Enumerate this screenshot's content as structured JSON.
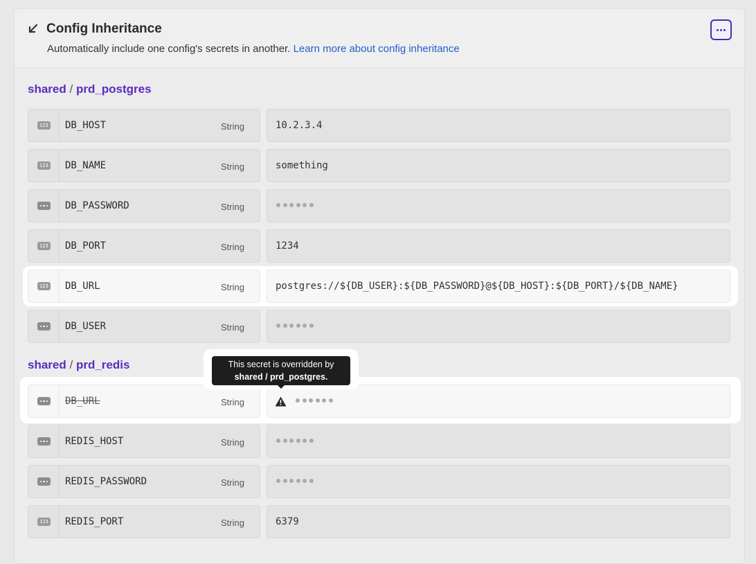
{
  "header": {
    "title": "Config Inheritance",
    "subtitle": "Automatically include one config's secrets in another.",
    "link": "Learn more about config inheritance"
  },
  "groups": [
    {
      "project": "shared",
      "config": "prd_postgres",
      "rows": [
        {
          "key": "DB_HOST",
          "type": "String",
          "value": "10.2.3.4",
          "icon": "number-icon"
        },
        {
          "key": "DB_NAME",
          "type": "String",
          "value": "something",
          "icon": "number-icon"
        },
        {
          "key": "DB_PASSWORD",
          "type": "String",
          "value": "",
          "icon": "masked-icon"
        },
        {
          "key": "DB_PORT",
          "type": "String",
          "value": "1234",
          "icon": "number-icon"
        },
        {
          "key": "DB_URL",
          "type": "String",
          "value": "postgres://${DB_USER}:${DB_PASSWORD}@${DB_HOST}:${DB_PORT}/${DB_NAME}",
          "icon": "number-icon"
        },
        {
          "key": "DB_USER",
          "type": "String",
          "value": "",
          "icon": "masked-icon"
        }
      ]
    },
    {
      "project": "shared",
      "config": "prd_redis",
      "rows": [
        {
          "key": "DB_URL",
          "type": "String",
          "value": "",
          "icon": "masked-icon"
        },
        {
          "key": "REDIS_HOST",
          "type": "String",
          "value": "",
          "icon": "masked-icon"
        },
        {
          "key": "REDIS_PASSWORD",
          "type": "String",
          "value": "",
          "icon": "masked-icon"
        },
        {
          "key": "REDIS_PORT",
          "type": "String",
          "value": "6379",
          "icon": "number-icon"
        }
      ]
    }
  ],
  "tooltip": {
    "line1": "This secret is overridden by",
    "line2": "shared / prd_postgres."
  },
  "icon_badge_text": "123",
  "separator": "/",
  "colors": {
    "accent": "#5b2bbd",
    "link": "#1f5fcc",
    "tooltip_bg": "#1e1e1e"
  }
}
